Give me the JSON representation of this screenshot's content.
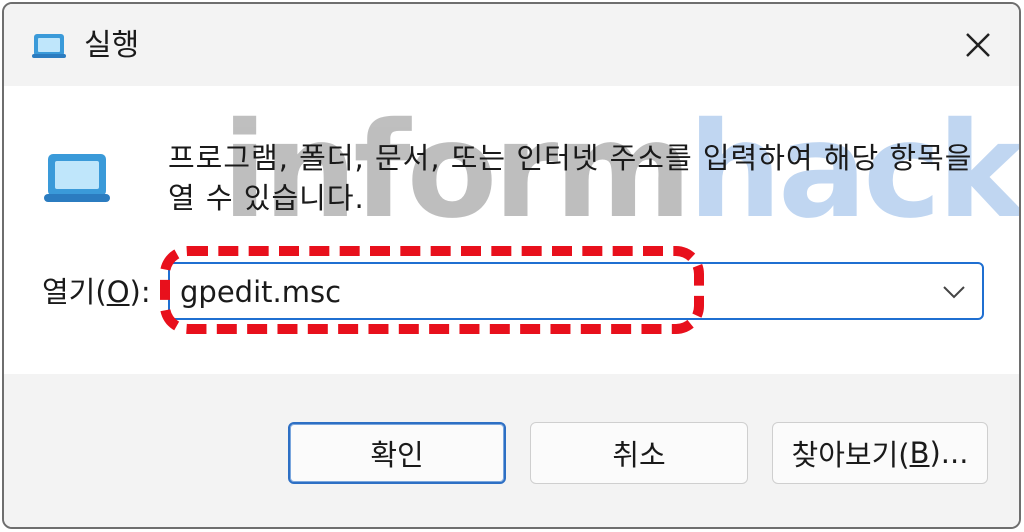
{
  "window": {
    "title": "실행",
    "title_icon": "run-dialog-icon",
    "close_icon": "close-icon"
  },
  "content": {
    "icon": "run-dialog-icon",
    "description": "프로그램, 폴더, 문서, 또는 인터넷 주소를 입력하여 해당 항목을 열 수 있습니다.",
    "watermark_part1": "inform",
    "watermark_part2": "hack"
  },
  "open_field": {
    "label_prefix": "열기(",
    "label_mnemonic": "O",
    "label_suffix": "):",
    "value": "gpedit.msc",
    "dropdown_icon": "chevron-down-icon"
  },
  "buttons": {
    "ok": "확인",
    "cancel": "취소",
    "browse_prefix": "찾아보기(",
    "browse_mnemonic": "B",
    "browse_suffix": ")..."
  },
  "colors": {
    "accent": "#1f6fd1",
    "highlight": "#e8101c",
    "dialog_bg": "#f3f3f3"
  }
}
